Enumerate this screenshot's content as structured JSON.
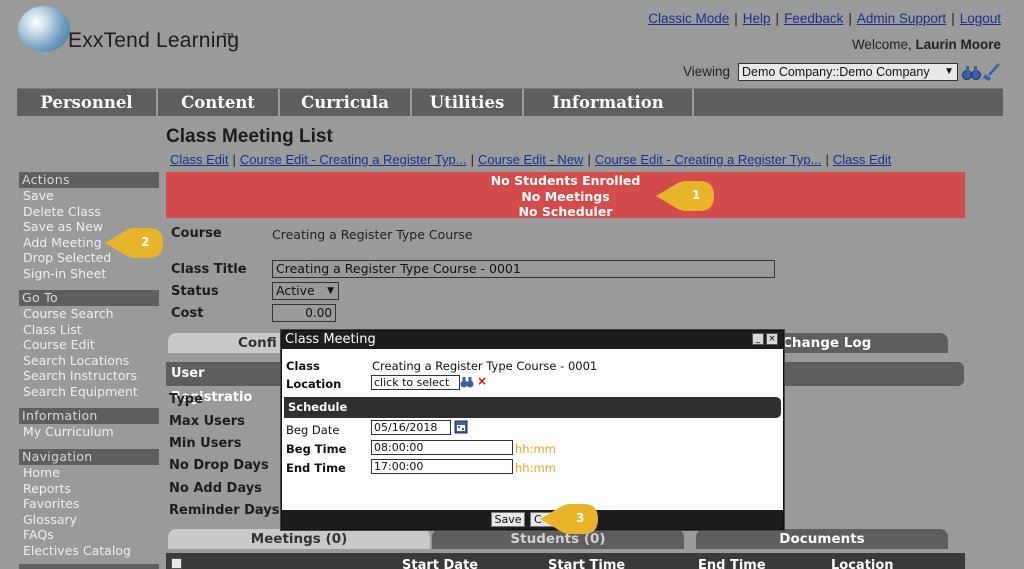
{
  "header": {
    "brand": "ExxTend Learning",
    "brand_tm": "TM",
    "links": [
      "Classic Mode",
      "Help",
      "Feedback",
      "Admin Support",
      "Logout"
    ],
    "welcome_prefix": "Welcome,",
    "user_name": "Laurin Moore",
    "viewing_label": "Viewing",
    "company_value": "Demo Company::Demo Company"
  },
  "nav": [
    "Personnel",
    "Content",
    "Curricula",
    "Utilities",
    "Information"
  ],
  "page": {
    "title": "Class Meeting List",
    "breadcrumb": [
      "Class Edit",
      "Course Edit - Creating a Register Typ...",
      "Course Edit - New",
      "Course Edit - Creating a Register Typ...",
      "Class Edit"
    ]
  },
  "sidebar": {
    "actions": {
      "title": "Actions",
      "items": [
        "Save",
        "Delete Class",
        "Save as New",
        "Add Meeting",
        "Drop Selected",
        "Sign-in Sheet"
      ]
    },
    "goto": {
      "title": "Go To",
      "items": [
        "Course Search",
        "Class List",
        "Course Edit",
        "Search Locations",
        "Search Instructors",
        "Search Equipment"
      ]
    },
    "information": {
      "title": "Information",
      "items": [
        "My Curriculum"
      ]
    },
    "navigation": {
      "title": "Navigation",
      "items": [
        "Home",
        "Reports",
        "Favorites",
        "Glossary",
        "FAQs",
        "Electives Catalog"
      ]
    }
  },
  "alert": [
    "No Students Enrolled",
    "No Meetings",
    "No Scheduler"
  ],
  "form": {
    "course_label": "Course",
    "course_value": "Creating a Register Type Course",
    "class_title_label": "Class Title",
    "class_title_value": "Creating a Register Type Course - 0001",
    "status_label": "Status",
    "status_value": "Active",
    "cost_label": "Cost",
    "cost_value": "0.00"
  },
  "tabs_top": {
    "config": "Confi",
    "change_log": "Change Log"
  },
  "user_reg": {
    "header": "User Registratio",
    "labels": [
      "Type",
      "Max Users",
      "Min Users",
      "No Drop Days",
      "No Add Days",
      "Reminder Days"
    ]
  },
  "tabs_bottom": [
    "Meetings (0)",
    "Students (0)",
    "Documents"
  ],
  "table_headers": [
    "Start Date",
    "Start Time",
    "End Time",
    "Location"
  ],
  "dialog": {
    "title": "Class Meeting",
    "class_label": "Class",
    "class_value": "Creating a Register Type Course - 0001",
    "location_label": "Location",
    "location_placeholder": "click to select",
    "schedule_title": "Schedule",
    "beg_date_label": "Beg Date",
    "beg_date_value": "05/16/2018",
    "beg_time_label": "Beg Time",
    "beg_time_value": "08:00:00",
    "end_time_label": "End Time",
    "end_time_value": "17:00:00",
    "time_hint": "hh:mm",
    "save_label": "Save",
    "cancel_label": "C"
  },
  "callouts": [
    "1",
    "2",
    "3"
  ],
  "colors": {
    "alert": "#d44b4b",
    "callout": "#e8b52a",
    "nav": "#5e5e5e",
    "link": "#1a2f8e"
  }
}
